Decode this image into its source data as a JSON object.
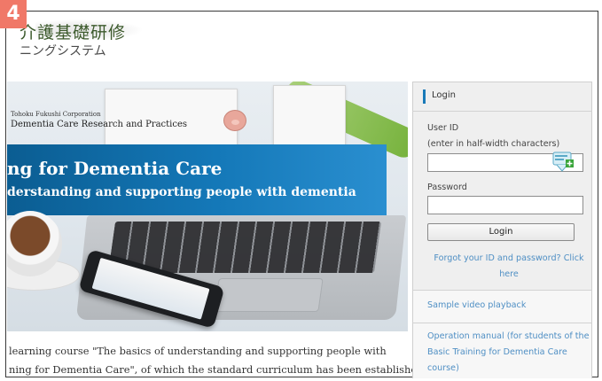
{
  "step_number": "4",
  "header": {
    "logo_title": "介護基礎研修",
    "logo_subtitle": "ニングシステム"
  },
  "hero": {
    "corp_text": "Tohoku Fukushi Corporation",
    "practice_text": "Dementia Care Research and Practices",
    "banner_title": "ng for Dementia Care",
    "banner_subtitle": "derstanding and supporting people with dementia"
  },
  "intro": {
    "line1": "learning course \"The basics of understanding and supporting people with",
    "line2": "ning for Dementia Care\", of which the standard curriculum has been established"
  },
  "login": {
    "heading": "Login",
    "user_id_label": "User ID",
    "user_id_hint": "(enter in half-width characters)",
    "user_id_value": "",
    "password_label": "Password",
    "password_value": "",
    "login_button": "Login",
    "forgot_link": "Forgot your ID and password? Click here"
  },
  "links": {
    "sample_video": "Sample video playback",
    "operation_manual": "Operation manual (for students of the Basic Training for Dementia Care course)"
  },
  "colors": {
    "badge": "#f07868",
    "banner": "#1478b8",
    "link": "#4f8fc4",
    "accent_bar": "#1a7ab8"
  },
  "icons": {
    "password_manager": "password-manager-icon"
  }
}
